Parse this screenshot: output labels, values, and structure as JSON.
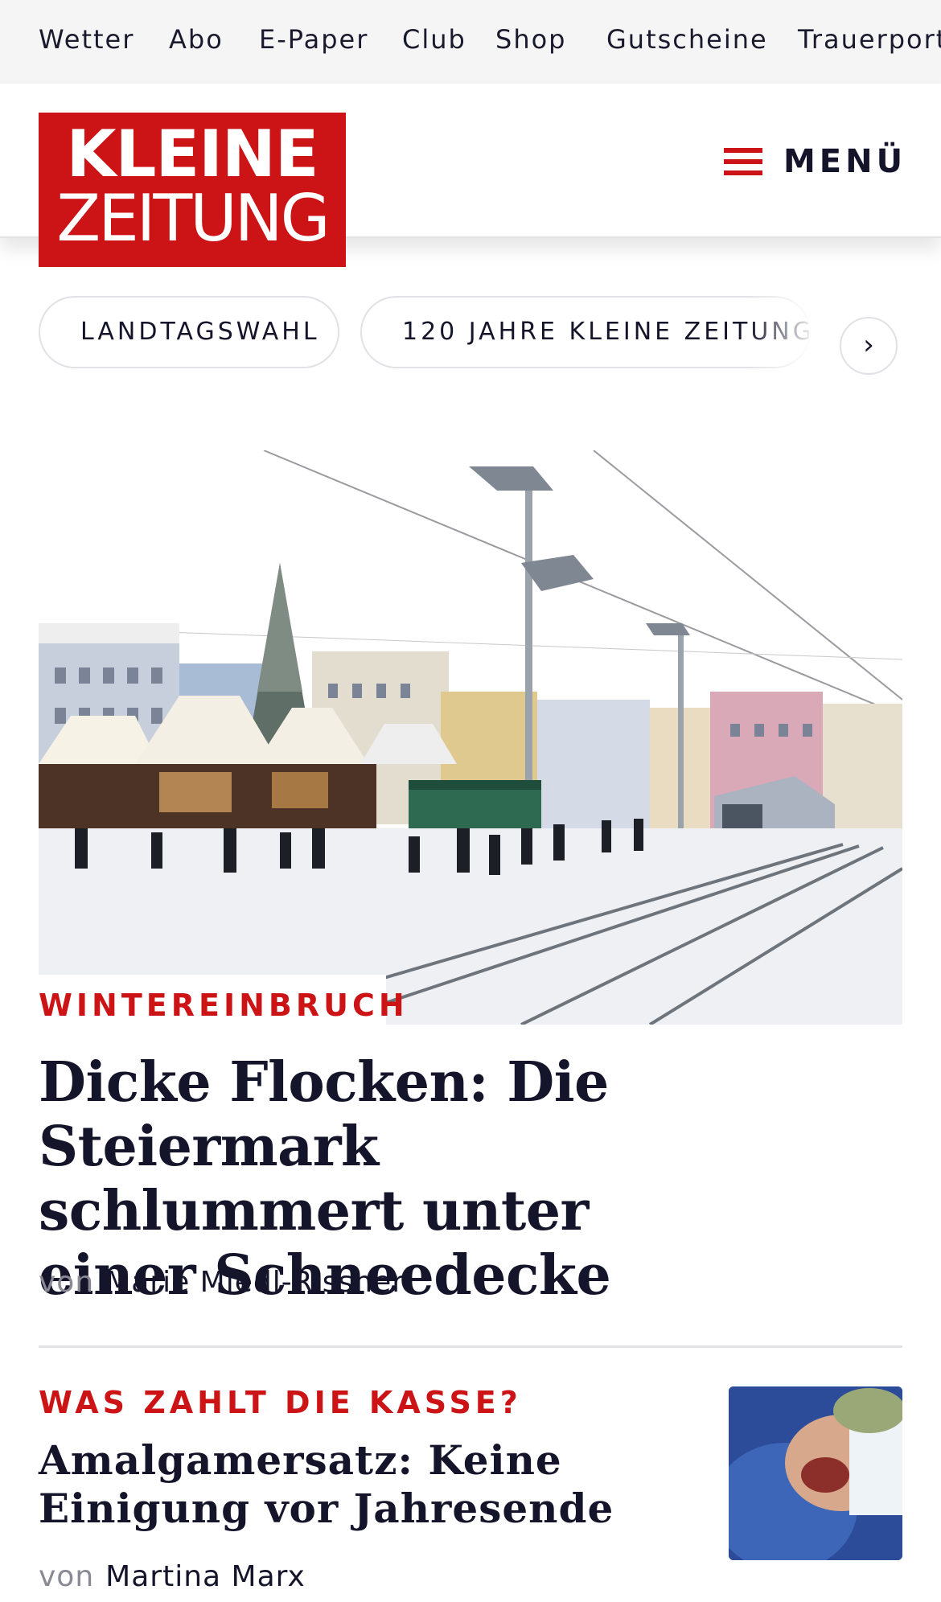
{
  "servicebar": {
    "items": [
      "Wetter",
      "Abo",
      "E-Paper",
      "Club",
      "Shop",
      "Gutscheine",
      "Trauerportal"
    ]
  },
  "header": {
    "logo_line1": "KLEINE",
    "logo_line2": "ZEITUNG",
    "menu_label": "MENÜ",
    "brand_color": "#cc1417"
  },
  "chips": {
    "items": [
      "LANDTAGSWAHL",
      "120 JAHRE KLEINE ZEITUNG"
    ]
  },
  "lead_article": {
    "kicker": "WINTEREINBRUCH",
    "title": "Dicke Flocken: Die Steiermark schlummert unter einer Schneedecke",
    "byline_prefix": "von",
    "author": "Marie Miedl-Rissner"
  },
  "second_article": {
    "kicker": "WAS ZAHLT DIE KASSE?",
    "title": "Amalgamersatz: Keine Einigung vor Jahresende",
    "byline_prefix": "von",
    "author": "Martina Marx"
  }
}
